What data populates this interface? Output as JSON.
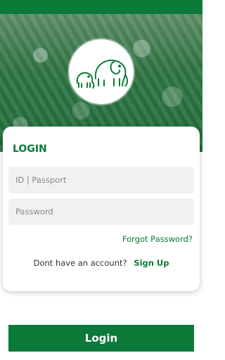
{
  "brand": {
    "primary_color": "#0b7a39"
  },
  "header": {
    "logo_icon": "elephants-icon"
  },
  "card": {
    "title": "LOGIN",
    "id_placeholder": "ID | Passport",
    "password_placeholder": "Password",
    "forgot_password": "Forgot Password?",
    "no_account_text": "Dont have an account?",
    "signup_label": "Sign Up"
  },
  "footer": {
    "login_label": "Login"
  }
}
